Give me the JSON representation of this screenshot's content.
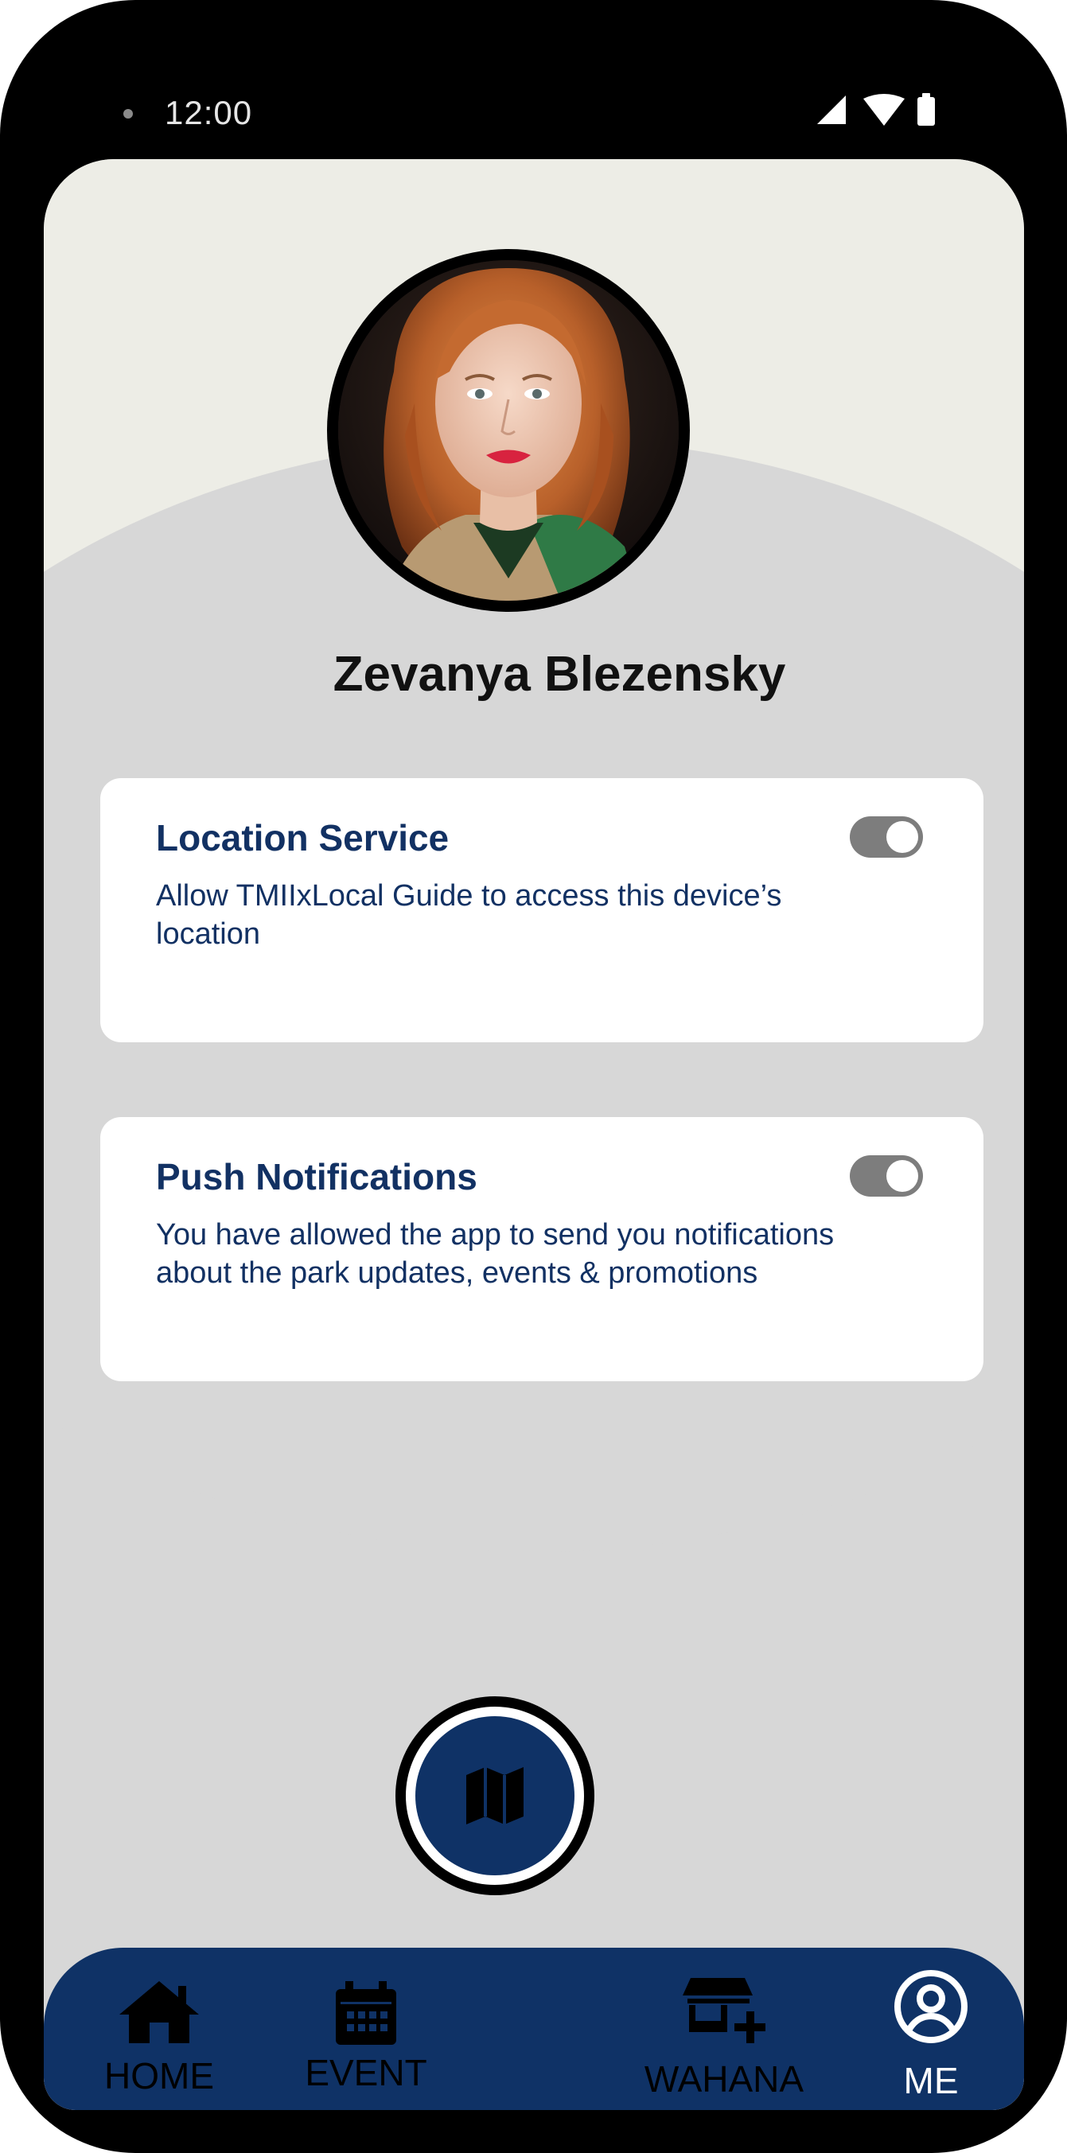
{
  "status_bar": {
    "time": "12:00",
    "icons": [
      "signal-icon",
      "wifi-icon",
      "battery-icon"
    ]
  },
  "profile": {
    "name": "Zevanya Blezensky"
  },
  "settings": [
    {
      "title": "Location Service",
      "description": "Allow TMIIxLocal Guide to access this device’s location",
      "enabled": true
    },
    {
      "title": "Push Notifications",
      "description": "You have allowed the app to send you notifications about the park updates, events & promotions",
      "enabled": true
    }
  ],
  "nav": {
    "items": [
      {
        "label": "HOME",
        "icon": "home-icon"
      },
      {
        "label": "EVENT",
        "icon": "calendar-icon"
      },
      {
        "label": "WAHANA",
        "icon": "store-add-icon"
      },
      {
        "label": "ME",
        "icon": "account-circle-icon"
      }
    ],
    "center_icon": "map-icon"
  },
  "colors": {
    "brand_navy": "#0f3266",
    "card_text": "#123163",
    "top_background": "#ededE6",
    "screen_background": "#d7d7d7",
    "toggle_track": "#7d7d7d"
  }
}
